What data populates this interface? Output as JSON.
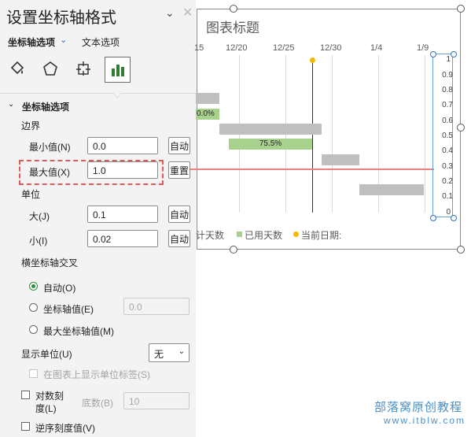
{
  "panel": {
    "title": "设置坐标轴格式",
    "tab_active": "坐标轴选项",
    "tab_text": "文本选项",
    "section": "坐标轴选项",
    "bounds_label": "边界",
    "min_label": "最小值(N)",
    "min_value": "0.0",
    "min_button": "自动",
    "max_label": "最大值(X)",
    "max_value": "1.0",
    "max_button": "重置",
    "units_label": "单位",
    "major_label": "大(J)",
    "major_value": "0.1",
    "major_button": "自动",
    "minor_label": "小(I)",
    "minor_value": "0.02",
    "minor_button": "自动",
    "cross_label": "横坐标轴交叉",
    "cross_auto": "自动(O)",
    "cross_value_label": "坐标轴值(E)",
    "cross_value": "0.0",
    "cross_max": "最大坐标轴值(M)",
    "display_units_label": "显示单位(U)",
    "display_units_value": "无",
    "show_units_label": "在图表上显示单位标签(S)",
    "log_label_1": "对数刻",
    "log_label_2": "度(L)",
    "base_label": "底数(B)",
    "base_value": "10",
    "reverse_label": "逆序刻度值(V)"
  },
  "chart": {
    "title": "图表标题",
    "x_ticks": [
      "15",
      "12/20",
      "12/25",
      "12/30",
      "1/4",
      "1/9"
    ],
    "y_ticks": [
      "1",
      "0.9",
      "0.8",
      "0.7",
      "0.6",
      "0.5",
      "0.4",
      "0.3",
      "0.2",
      "0.1",
      "0"
    ],
    "bar_label_1": "0.0%",
    "bar_label_2": "75.5%",
    "legend_1": "计天数",
    "legend_2": "已用天数",
    "legend_3": "当前日期:"
  },
  "colors": {
    "gray_bar": "#bfbfbf",
    "green_bar": "#a9d18e",
    "today_dot": "#f5b800",
    "highlight": "#e05a5a"
  },
  "watermark": {
    "line1": "部落窝原创教程",
    "line2": "www.itblw.com"
  }
}
